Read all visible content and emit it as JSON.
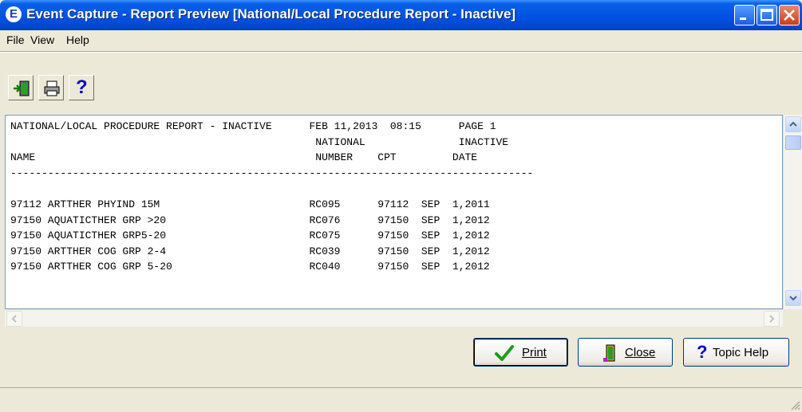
{
  "window": {
    "title": "Event Capture - Report Preview [National/Local Procedure Report - Inactive]",
    "app_icon_glyph": "E"
  },
  "menu": {
    "items": [
      {
        "label": "File",
        "mnemonic": "F"
      },
      {
        "label": "View",
        "mnemonic": "V"
      },
      {
        "label": "Help",
        "mnemonic": "H"
      }
    ]
  },
  "toolbar": {
    "buttons": [
      {
        "icon": "exit-door-icon",
        "tooltip": ""
      },
      {
        "icon": "printer-icon",
        "tooltip": ""
      },
      {
        "icon": "question-mark-icon",
        "tooltip": ""
      }
    ],
    "help_glyph": "?"
  },
  "report": {
    "lines": [
      "NATIONAL/LOCAL PROCEDURE REPORT - INACTIVE      FEB 11,2013  08:15      PAGE 1",
      "                                                 NATIONAL               INACTIVE",
      "NAME                                             NUMBER    CPT         DATE",
      "------------------------------------------------------------------------------------",
      "",
      "97112 ARTTHER PHYIND 15M                        RC095      97112  SEP  1,2011",
      "97150 AQUATICTHER GRP >20                       RC076      97150  SEP  1,2012",
      "97150 AQUATICTHER GRP5-20                       RC075      97150  SEP  1,2012",
      "97150 ARTTHER COG GRP 2-4                       RC039      97150  SEP  1,2012",
      "97150 ARTTHER COG GRP 5-20                      RC040      97150  SEP  1,2012"
    ]
  },
  "buttons": {
    "print": {
      "label": "Print",
      "mnemonic": "P"
    },
    "close": {
      "label": "Close",
      "mnemonic": "C"
    },
    "topic_help": {
      "label": "Topic Help",
      "mnemonic": "T"
    }
  },
  "colors": {
    "title_bar": "#0054e3",
    "window_face": "#ece9d8",
    "close_button": "#c53f1c"
  }
}
